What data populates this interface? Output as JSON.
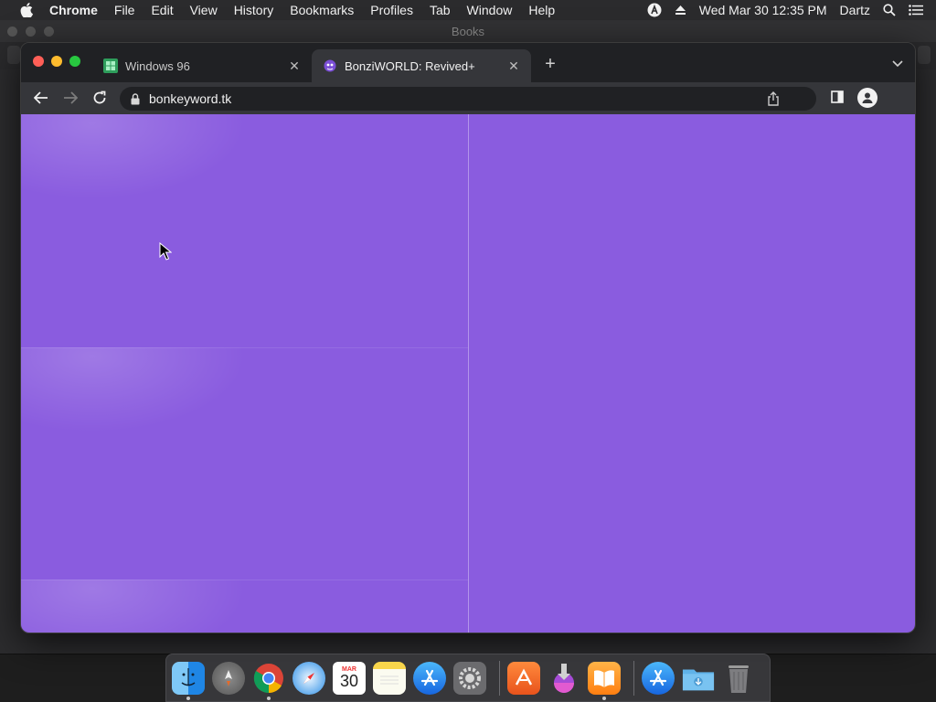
{
  "menubar": {
    "app_name": "Chrome",
    "items": [
      "File",
      "Edit",
      "View",
      "History",
      "Bookmarks",
      "Profiles",
      "Tab",
      "Window",
      "Help"
    ],
    "datetime": "Wed Mar 30  12:35 PM",
    "user": "Dartz"
  },
  "background_window": {
    "title": "Books"
  },
  "browser": {
    "tabs": [
      {
        "title": "Windows 96",
        "favicon": "windows96-favicon",
        "active": false
      },
      {
        "title": "BonziWORLD: Revived+",
        "favicon": "bonziworld-favicon",
        "active": true
      }
    ],
    "url": "bonkeyword.tk"
  },
  "page": {
    "background_color": "#8a5cdf"
  },
  "dock": {
    "apps": [
      "finder-icon",
      "launchpad-icon",
      "chrome-icon",
      "safari-icon",
      "calendar-icon",
      "notes-icon",
      "app-store-icon",
      "system-preferences-icon",
      "|",
      "app-icon",
      "installer-icon",
      "books-icon",
      "|",
      "app-store-folder-icon",
      "downloads-folder-icon",
      "trash-icon"
    ],
    "calendar_month": "MAR",
    "calendar_day": "30"
  }
}
